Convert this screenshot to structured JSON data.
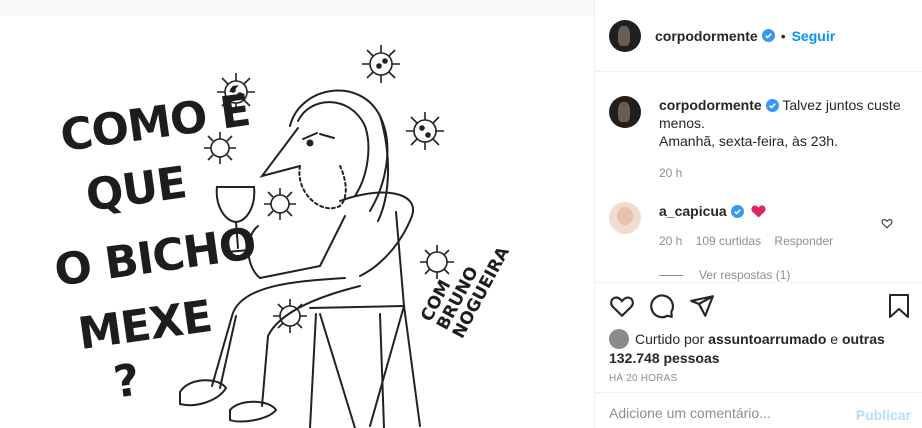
{
  "post": {
    "image_text": {
      "title_line1": "COMO É",
      "title_line2": "QUE",
      "title_line3": "O BICHO",
      "title_line4": "MEXE",
      "title_qmark": "?",
      "credit_line1": "COM",
      "credit_line2": "BRUNO",
      "credit_line3": "NOGUEIRA"
    },
    "header": {
      "username": "corpodormente",
      "separator": "•",
      "follow_label": "Seguir"
    },
    "caption": {
      "username": "corpodormente",
      "text_line1": "Talvez juntos custe menos.",
      "text_line2": "Amanhã, sexta-feira, às 23h.",
      "time": "20 h"
    },
    "comment": {
      "username": "a_capicua",
      "time": "20 h",
      "likes": "109 curtidas",
      "reply_label": "Responder",
      "view_replies": "Ver respostas (1)"
    },
    "likes": {
      "prefix": "Curtido por",
      "user": "assuntoarrumado",
      "and": "e",
      "others": "outras 132.748 pessoas"
    },
    "timestamp": "HÁ 20 HORAS",
    "add_comment": {
      "placeholder": "Adicione um comentário...",
      "publish_label": "Publicar"
    },
    "colors": {
      "accent": "#0095f6",
      "publish_disabled": "#b2dffc",
      "heart": "#ed4956",
      "muted": "#8e8e8e"
    },
    "icons": [
      "verified-icon",
      "heart-icon",
      "comment-icon",
      "share-icon",
      "bookmark-icon",
      "red-heart-emoji"
    ]
  }
}
